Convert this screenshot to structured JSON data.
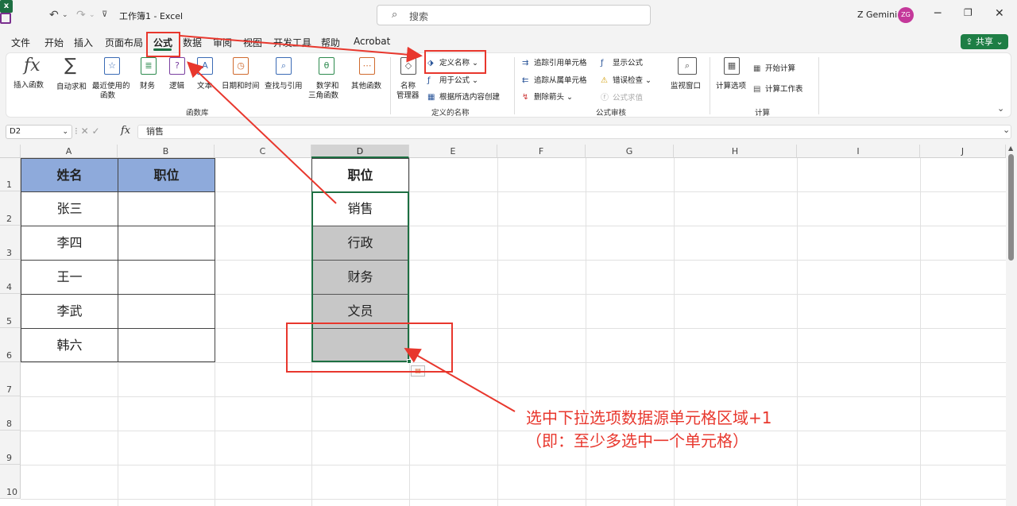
{
  "window": {
    "doc_title": "工作簿1 - Excel",
    "search_placeholder": "搜索",
    "user_name": "Z Gemini",
    "avatar_initials": "ZG",
    "share_label": "共享"
  },
  "menu": [
    "文件",
    "开始",
    "插入",
    "页面布局",
    "公式",
    "数据",
    "审阅",
    "视图",
    "开发工具",
    "帮助",
    "Acrobat"
  ],
  "active_menu": "公式",
  "ribbon": {
    "function_library": {
      "insert_function": "插入函数",
      "autosum": "自动求和",
      "recently_used_1": "最近使用的",
      "recently_used_2": "函数",
      "financial": "财务",
      "logical": "逻辑",
      "text": "文本",
      "datetime": "日期和时间",
      "lookup": "查找与引用",
      "math_1": "数学和",
      "math_2": "三角函数",
      "more": "其他函数",
      "group_label": "函数库"
    },
    "defined_names": {
      "name_manager_1": "名称",
      "name_manager_2": "管理器",
      "define_name": "定义名称",
      "use_in_formula": "用于公式",
      "create_from_selection": "根据所选内容创建",
      "group_label": "定义的名称"
    },
    "formula_auditing": {
      "trace_precedents": "追踪引用单元格",
      "trace_dependents": "追踪从属单元格",
      "remove_arrows": "删除箭头",
      "show_formulas": "显示公式",
      "error_checking": "错误检查",
      "evaluate_formula": "公式求值",
      "watch_window": "监视窗口",
      "group_label": "公式审核"
    },
    "calculation": {
      "calc_options": "计算选项",
      "calc_now": "开始计算",
      "calc_sheet": "计算工作表",
      "group_label": "计算"
    }
  },
  "formula_bar": {
    "name_box": "D2",
    "fx": "fx",
    "content": "销售"
  },
  "columns": [
    "A",
    "B",
    "C",
    "D",
    "E",
    "F",
    "G",
    "H",
    "I",
    "J"
  ],
  "rows": [
    "1",
    "2",
    "3",
    "4",
    "5",
    "6",
    "7",
    "8",
    "9",
    "10"
  ],
  "cells": {
    "A1": "姓名",
    "B1": "职位",
    "A2": "张三",
    "A3": "李四",
    "A4": "王一",
    "A5": "李武",
    "A6": "韩六",
    "D1": "职位",
    "D2": "销售",
    "D3": "行政",
    "D4": "财务",
    "D5": "文员"
  },
  "annotation": {
    "line1": "选中下拉选项数据源单元格区域+1",
    "line2": "（即：至少多选中一个单元格）",
    "color": "#e8372d"
  },
  "colors": {
    "header_fill": "#8eaadb",
    "selected_fill": "#c7c7c7",
    "excel_green": "#1d6f42"
  }
}
